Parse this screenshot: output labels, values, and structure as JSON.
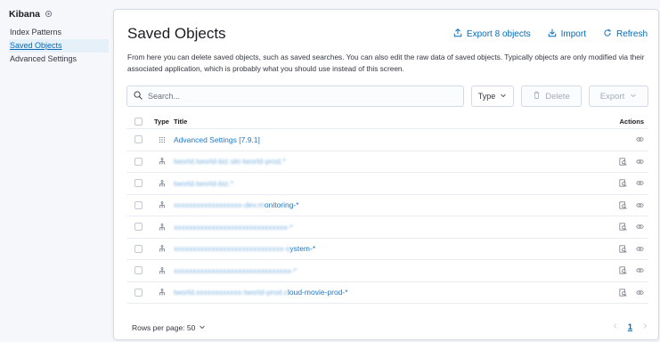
{
  "sidebar": {
    "title": "Kibana",
    "items": [
      {
        "label": "Index Patterns",
        "active": false
      },
      {
        "label": "Saved Objects",
        "active": true
      },
      {
        "label": "Advanced Settings",
        "active": false
      }
    ]
  },
  "header": {
    "title": "Saved Objects",
    "export_label": "Export 8 objects",
    "import_label": "Import",
    "refresh_label": "Refresh"
  },
  "description": "From here you can delete saved objects, such as saved searches. You can also edit the raw data of saved objects. Typically objects are only modified via their associated application, which is probably what you should use instead of this screen.",
  "toolbar": {
    "search_placeholder": "Search...",
    "search_value": "",
    "type_label": "Type",
    "delete_label": "Delete",
    "export_label": "Export"
  },
  "table": {
    "columns": {
      "type": "Type",
      "title": "Title",
      "actions": "Actions"
    },
    "rows": [
      {
        "type_icon": "settings-icon",
        "clear": "Advanced Settings [7.9.1]",
        "blurred": "",
        "suffix": "",
        "inspect": false
      },
      {
        "type_icon": "index-pattern-icon",
        "clear": "",
        "blurred": "tworld.tworld-biz.skt-tworld-prod.*",
        "suffix": "",
        "inspect": true
      },
      {
        "type_icon": "index-pattern-icon",
        "clear": "",
        "blurred": "tworld.tworld-biz.*",
        "suffix": "",
        "inspect": true
      },
      {
        "type_icon": "index-pattern-icon",
        "clear": "",
        "blurred": "xxxxxxxxxxxxxxxxxx-dev.m",
        "suffix": "onitoring-*",
        "inspect": true
      },
      {
        "type_icon": "index-pattern-icon",
        "clear": "",
        "blurred": "xxxxxxxxxxxxxxxxxxxxxxxxxxxxxx-*",
        "suffix": "",
        "inspect": true
      },
      {
        "type_icon": "index-pattern-icon",
        "clear": "",
        "blurred": "xxxxxxxxxxxxxxxxxxxxxxxxxxxxx-s",
        "suffix": "ystem-*",
        "inspect": true
      },
      {
        "type_icon": "index-pattern-icon",
        "clear": "",
        "blurred": "xxxxxxxxxxxxxxxxxxxxxxxxxxxxxxx-*",
        "suffix": "",
        "inspect": true
      },
      {
        "type_icon": "index-pattern-icon",
        "clear": "",
        "blurred": "tworld.xxxxxxxxxxxx-tworld-prod.c",
        "suffix": "loud-movie-prod-*",
        "inspect": true
      }
    ]
  },
  "footer": {
    "rows_per_page": "Rows per page: 50",
    "current_page": "1"
  },
  "colors": {
    "link": "#006bb8",
    "text": "#343741",
    "border": "#d3dae6",
    "background": "#f5f7fa"
  }
}
